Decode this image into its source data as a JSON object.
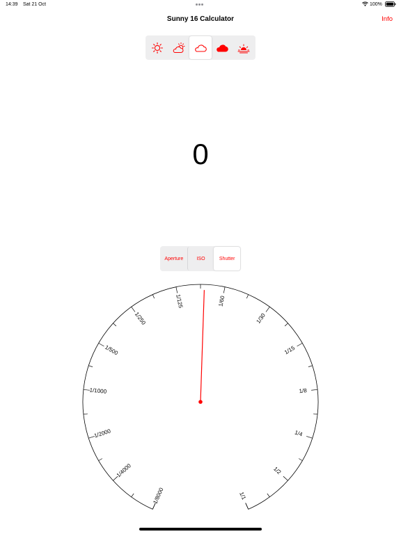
{
  "status_bar": {
    "time": "14:39",
    "date": "Sat 21 Oct",
    "battery": "100%"
  },
  "header": {
    "title": "Sunny 16 Calculator",
    "info_label": "Info"
  },
  "weather": {
    "options": [
      {
        "icon": "sun-icon"
      },
      {
        "icon": "partly-cloudy-icon"
      },
      {
        "icon": "cloud-icon"
      },
      {
        "icon": "heavy-cloud-icon"
      },
      {
        "icon": "sunset-icon"
      }
    ],
    "selected_index": 2
  },
  "result": {
    "value": "0"
  },
  "mode": {
    "options": [
      "Aperture",
      "ISO",
      "Shutter"
    ],
    "selected": "Shutter"
  },
  "dial": {
    "labels": [
      "1/8000",
      "1/4000",
      "1/2000",
      "1/1000",
      "1/500",
      "1/250",
      "1/125",
      "1/60",
      "1/30",
      "1/15",
      "1/8",
      "1/4",
      "1/2",
      "1/1"
    ],
    "pointer_value": "1/125",
    "accent_color": "#ff0000"
  },
  "colors": {
    "accent": "#ff0000",
    "segment_bg": "#eeeeef"
  }
}
